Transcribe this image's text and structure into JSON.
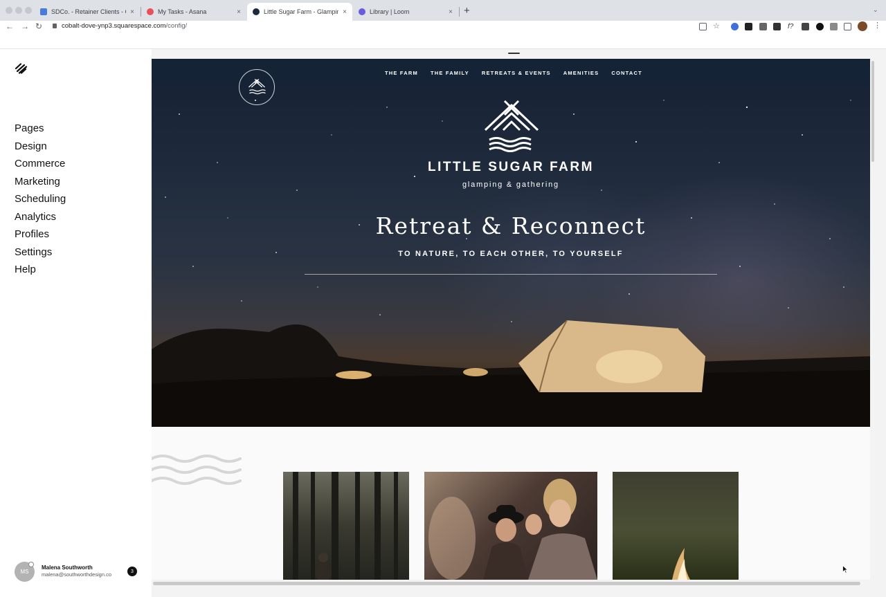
{
  "browser": {
    "tabs": [
      {
        "title": "SDCo. - Retainer Clients - Goo",
        "close": "×",
        "favicon_color": "#4a7bd6"
      },
      {
        "title": "My Tasks - Asana",
        "close": "×",
        "favicon_color": "#e8505b"
      },
      {
        "title": "Little Sugar Farm - Glamping &",
        "close": "×",
        "favicon_color": "#1e2b3c"
      },
      {
        "title": "Library | Loom",
        "close": "×",
        "favicon_color": "#6a5ae0"
      }
    ],
    "new_tab": "+",
    "tab_menu": "⌄",
    "url_host": "cobalt-dove-ynp3.squarespace.com",
    "url_path": "/config/",
    "nav": {
      "back": "←",
      "forward": "→",
      "reload": "↻"
    }
  },
  "sidebar": {
    "menu": [
      "Pages",
      "Design",
      "Commerce",
      "Marketing",
      "Scheduling",
      "Analytics",
      "Profiles",
      "Settings",
      "Help"
    ],
    "user": {
      "initials": "MS",
      "name": "Malena Southworth",
      "email": "malena@southworthdesign.co",
      "notifications": "3"
    }
  },
  "site": {
    "nav": [
      "THE FARM",
      "THE FAMILY",
      "RETREATS & EVENTS",
      "AMENITIES",
      "CONTACT"
    ],
    "brand_name": "LITTLE SUGAR FARM",
    "brand_tagline": "glamping & gathering",
    "headline": "Retreat & Reconnect",
    "subheadline": "TO NATURE, TO EACH OTHER, TO YOURSELF"
  },
  "icons": {
    "squarespace_logo": "squarespace-logo-icon",
    "farm_badge": "farm-badge-icon",
    "tent": "tent-logo-icon",
    "waves": "waves-icon",
    "cursor": "mouse-cursor-icon"
  }
}
